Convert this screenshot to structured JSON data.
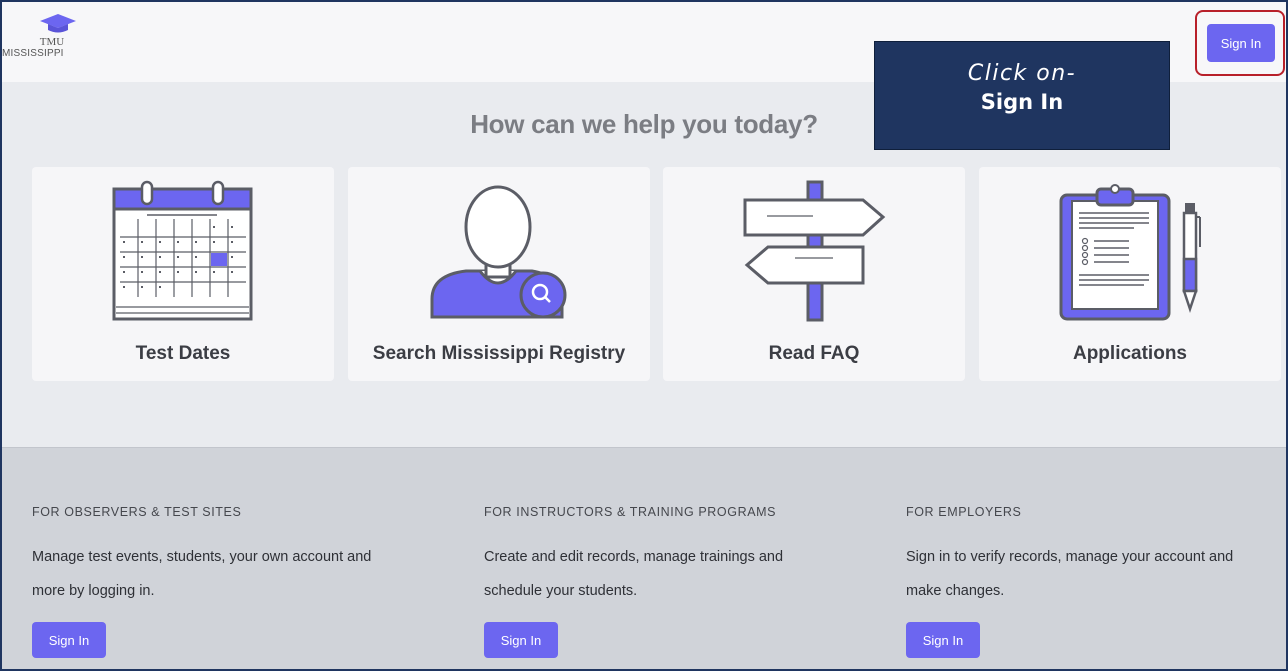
{
  "header": {
    "logo_top": "TMU",
    "logo_bottom": "MISSISSIPPI",
    "signin_label": "Sign In"
  },
  "callout": {
    "line1": "Click on-",
    "line2": "Sign In"
  },
  "main": {
    "heading": "How can we help you today?",
    "cards": [
      {
        "label": "Test Dates",
        "icon": "calendar-icon"
      },
      {
        "label": "Search Mississippi Registry",
        "icon": "person-search-icon"
      },
      {
        "label": "Read FAQ",
        "icon": "signpost-icon"
      },
      {
        "label": "Applications",
        "icon": "clipboard-icon"
      }
    ]
  },
  "footer": {
    "columns": [
      {
        "title": "FOR OBSERVERS & TEST SITES",
        "line1": "Manage test events, students, your own account and",
        "line2": "more by logging in.",
        "button": "Sign In"
      },
      {
        "title": "FOR INSTRUCTORS & TRAINING PROGRAMS",
        "line1": "Create and edit records, manage trainings and",
        "line2": "schedule your students.",
        "button": "Sign In"
      },
      {
        "title": "FOR EMPLOYERS",
        "line1": "Sign in to verify records, manage your account and",
        "line2": "make changes.",
        "button": "Sign In"
      }
    ]
  },
  "colors": {
    "accent": "#6c66f0",
    "callout_bg": "#1f3560",
    "highlight_border": "#b8202a"
  }
}
